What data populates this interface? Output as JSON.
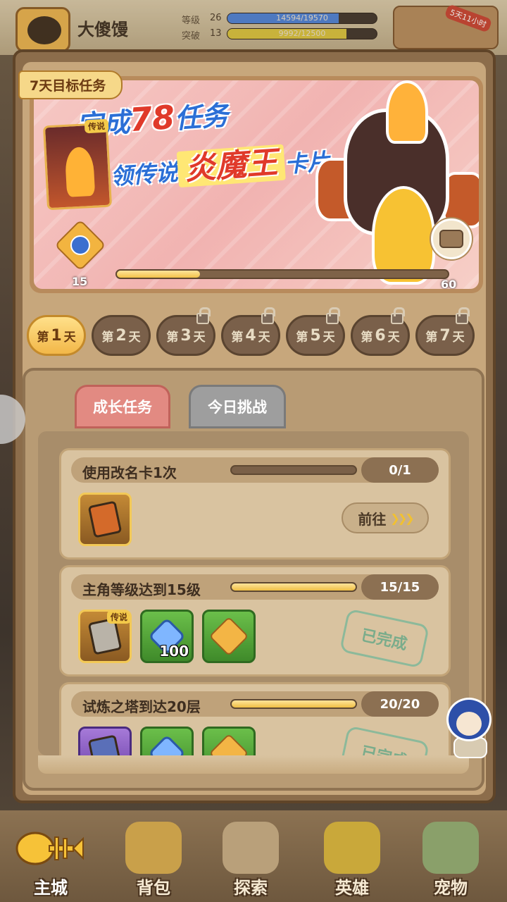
{
  "player": {
    "name": "大傻馒",
    "level_label": "等级",
    "level_value": "26",
    "exp_text": "14594/19570",
    "exp_progress": 0.746,
    "breakthrough_label": "突破",
    "breakthrough_value": "13",
    "breakthrough_text": "9992/12500",
    "breakthrough_progress": 0.799,
    "promo_tag": "5天11小时"
  },
  "banner": {
    "tag": "7天目标任务",
    "headline_prefix": "完成",
    "headline_highlight": "78",
    "headline_suffix": "任务",
    "reward_prefix": "领传说",
    "reward_name": "炎魔王",
    "reward_suffix": "卡片",
    "card_badge": "传说",
    "progress_current": "15",
    "progress_max": "60",
    "progress_ratio": 0.25
  },
  "day_tabs": [
    {
      "prefix": "第",
      "num": "1",
      "suffix": "天",
      "active": true,
      "locked": false
    },
    {
      "prefix": "第",
      "num": "2",
      "suffix": "天",
      "active": false,
      "locked": false
    },
    {
      "prefix": "第",
      "num": "3",
      "suffix": "天",
      "active": false,
      "locked": true
    },
    {
      "prefix": "第",
      "num": "4",
      "suffix": "天",
      "active": false,
      "locked": true
    },
    {
      "prefix": "第",
      "num": "5",
      "suffix": "天",
      "active": false,
      "locked": true
    },
    {
      "prefix": "第",
      "num": "6",
      "suffix": "天",
      "active": false,
      "locked": true
    },
    {
      "prefix": "第",
      "num": "7",
      "suffix": "天",
      "active": false,
      "locked": true
    }
  ],
  "task_tabs": {
    "growth": "成长任务",
    "daily": "今日挑战"
  },
  "tasks": [
    {
      "title": "使用改名卡1次",
      "count": "0/1",
      "progress": 0.0,
      "action": "前往",
      "rewards": [
        {
          "kind": "rename-card",
          "rarity": "gold"
        }
      ]
    },
    {
      "title": "主角等级达到15级",
      "count": "15/15",
      "progress": 1.0,
      "status": "已完成",
      "rewards": [
        {
          "kind": "hero-card",
          "rarity": "gold",
          "tier": "传说"
        },
        {
          "kind": "gem",
          "rarity": "green",
          "qty": "100"
        },
        {
          "kind": "medal",
          "rarity": "green"
        }
      ]
    },
    {
      "title": "试炼之塔到达20层",
      "count": "20/20",
      "progress": 1.0,
      "status": "已完成",
      "rewards": [
        {
          "kind": "card",
          "rarity": "purple"
        },
        {
          "kind": "gem",
          "rarity": "green"
        },
        {
          "kind": "medal",
          "rarity": "green"
        }
      ]
    }
  ],
  "bottom_nav": [
    {
      "label": "主城",
      "icon": "fish-bone-icon",
      "active": true
    },
    {
      "label": "背包",
      "icon": "backpack-icon",
      "active": false
    },
    {
      "label": "探索",
      "icon": "map-scroll-icon",
      "active": false
    },
    {
      "label": "英雄",
      "icon": "hero-icon",
      "active": false
    },
    {
      "label": "宠物",
      "icon": "pet-icon",
      "active": false
    }
  ],
  "colors": {
    "accent_gold": "#f2b748",
    "growth_tab": "#e28a82",
    "daily_tab": "#9e9e9e",
    "done_stamp": "#6aa888",
    "headline_blue": "#2b6fd6",
    "headline_red": "#e03a2a"
  }
}
